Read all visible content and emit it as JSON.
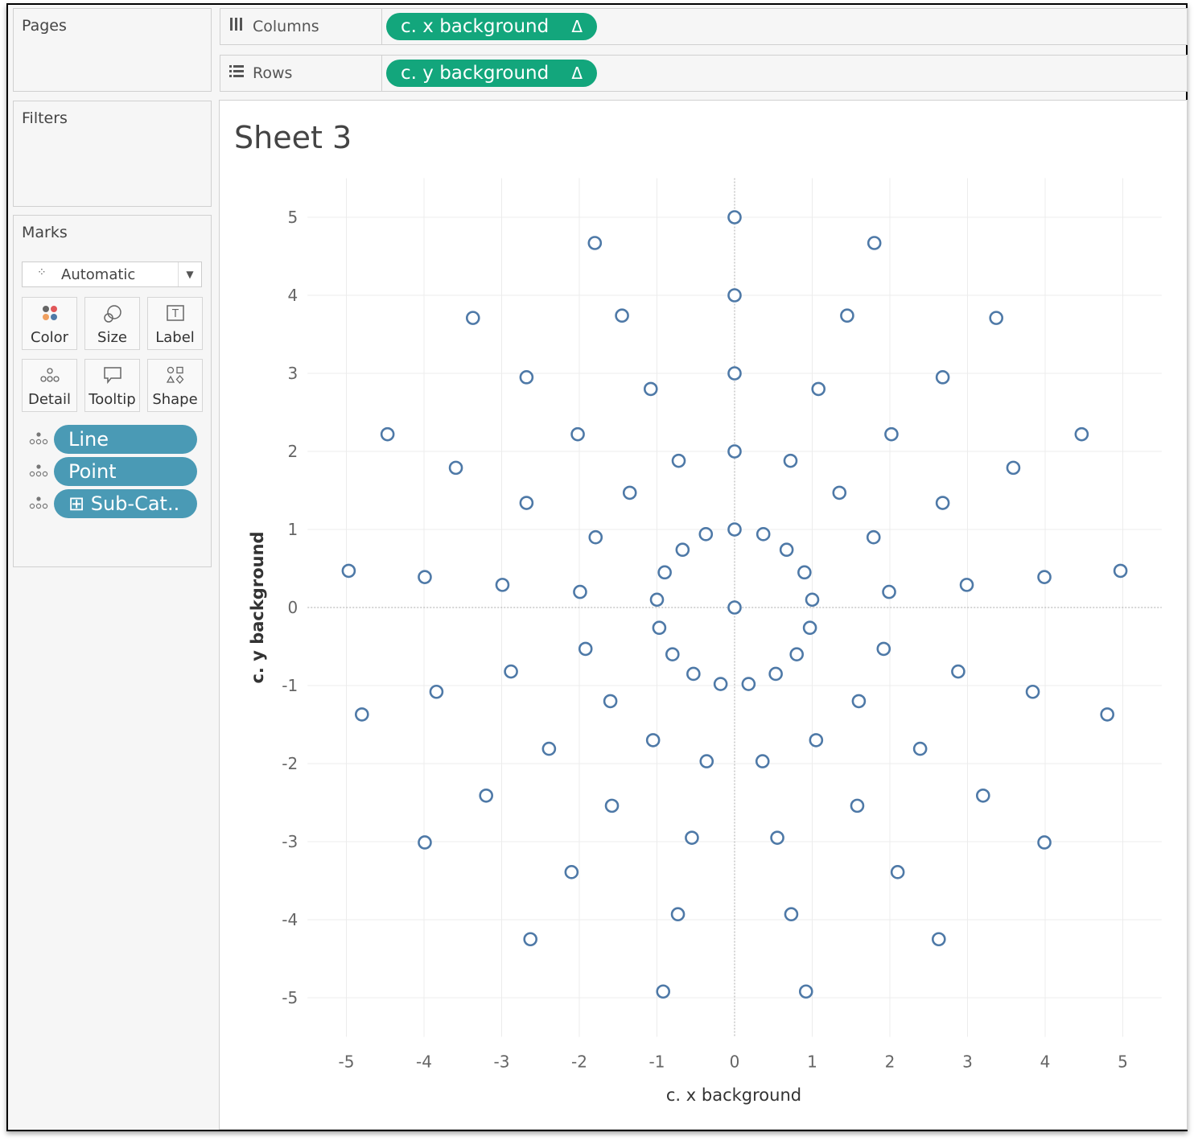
{
  "pages": {
    "title": "Pages"
  },
  "filters": {
    "title": "Filters"
  },
  "marks": {
    "title": "Marks",
    "mark_type": "Automatic",
    "buttons": [
      {
        "label": "Color",
        "icon": "color-icon"
      },
      {
        "label": "Size",
        "icon": "size-icon"
      },
      {
        "label": "Label",
        "icon": "label-icon"
      },
      {
        "label": "Detail",
        "icon": "detail-icon"
      },
      {
        "label": "Tooltip",
        "icon": "tooltip-icon"
      },
      {
        "label": "Shape",
        "icon": "shape-icon"
      }
    ],
    "fields": [
      {
        "label": "Line",
        "icon": "detail-icon"
      },
      {
        "label": "Point",
        "icon": "detail-icon"
      },
      {
        "label": "⊞ Sub-Cat..",
        "icon": "detail-icon"
      }
    ]
  },
  "shelves": {
    "columns": {
      "label": "Columns",
      "pill": "c. x background",
      "pill_symbol": "Δ"
    },
    "rows": {
      "label": "Rows",
      "pill": "c. y background",
      "pill_symbol": "Δ"
    }
  },
  "sheet": {
    "title": "Sheet 3"
  },
  "colors": {
    "pill_green": "#13a67c",
    "pill_blue": "#4a9ab5",
    "mark": "#4e79a7"
  },
  "chart_data": {
    "type": "scatter",
    "xlabel": "c. x background",
    "ylabel": "c. y background",
    "xlim": [
      -5.5,
      5.5
    ],
    "ylim": [
      -5.5,
      5.5
    ],
    "xticks": [
      -5,
      -4,
      -3,
      -2,
      -1,
      0,
      1,
      2,
      3,
      4,
      5
    ],
    "yticks": [
      5,
      4,
      3,
      2,
      1,
      0,
      -1,
      -2,
      -3,
      -4,
      -5
    ],
    "grid": true,
    "zero_lines": true,
    "marker": "hollow-circle",
    "points": [
      [
        0,
        5
      ],
      [
        -1.8,
        4.67
      ],
      [
        1.8,
        4.67
      ],
      [
        0,
        4
      ],
      [
        -1.45,
        3.74
      ],
      [
        1.45,
        3.74
      ],
      [
        -3.37,
        3.71
      ],
      [
        3.37,
        3.71
      ],
      [
        0,
        3
      ],
      [
        -2.68,
        2.95
      ],
      [
        2.68,
        2.95
      ],
      [
        -1.08,
        2.8
      ],
      [
        1.08,
        2.8
      ],
      [
        -4.47,
        2.22
      ],
      [
        -2.02,
        2.22
      ],
      [
        2.02,
        2.22
      ],
      [
        4.47,
        2.22
      ],
      [
        0,
        2
      ],
      [
        -0.72,
        1.88
      ],
      [
        0.72,
        1.88
      ],
      [
        -3.59,
        1.79
      ],
      [
        3.59,
        1.79
      ],
      [
        -1.35,
        1.47
      ],
      [
        1.35,
        1.47
      ],
      [
        -2.68,
        1.34
      ],
      [
        2.68,
        1.34
      ],
      [
        0,
        1
      ],
      [
        -0.37,
        0.94
      ],
      [
        0.37,
        0.94
      ],
      [
        -1.79,
        0.9
      ],
      [
        1.79,
        0.9
      ],
      [
        -0.67,
        0.74
      ],
      [
        0.67,
        0.74
      ],
      [
        -4.97,
        0.47
      ],
      [
        -0.9,
        0.45
      ],
      [
        0.9,
        0.45
      ],
      [
        4.97,
        0.47
      ],
      [
        -3.99,
        0.39
      ],
      [
        3.99,
        0.39
      ],
      [
        -2.99,
        0.29
      ],
      [
        2.99,
        0.29
      ],
      [
        -1.99,
        0.2
      ],
      [
        1.99,
        0.2
      ],
      [
        -1,
        0.1
      ],
      [
        1,
        0.1
      ],
      [
        0,
        0
      ],
      [
        -0.97,
        -0.26
      ],
      [
        0.97,
        -0.26
      ],
      [
        -1.92,
        -0.53
      ],
      [
        1.92,
        -0.53
      ],
      [
        -0.8,
        -0.6
      ],
      [
        0.8,
        -0.6
      ],
      [
        -2.88,
        -0.82
      ],
      [
        2.88,
        -0.82
      ],
      [
        -0.53,
        -0.85
      ],
      [
        0.53,
        -0.85
      ],
      [
        -0.18,
        -0.98
      ],
      [
        0.18,
        -0.98
      ],
      [
        -3.84,
        -1.08
      ],
      [
        3.84,
        -1.08
      ],
      [
        -1.6,
        -1.2
      ],
      [
        1.6,
        -1.2
      ],
      [
        -4.8,
        -1.37
      ],
      [
        4.8,
        -1.37
      ],
      [
        -1.05,
        -1.7
      ],
      [
        1.05,
        -1.7
      ],
      [
        -2.39,
        -1.81
      ],
      [
        2.39,
        -1.81
      ],
      [
        -0.36,
        -1.97
      ],
      [
        0.36,
        -1.97
      ],
      [
        -3.2,
        -2.41
      ],
      [
        3.2,
        -2.41
      ],
      [
        -1.58,
        -2.54
      ],
      [
        1.58,
        -2.54
      ],
      [
        -0.55,
        -2.95
      ],
      [
        0.55,
        -2.95
      ],
      [
        -3.99,
        -3.01
      ],
      [
        3.99,
        -3.01
      ],
      [
        -2.1,
        -3.39
      ],
      [
        2.1,
        -3.39
      ],
      [
        -0.73,
        -3.93
      ],
      [
        0.73,
        -3.93
      ],
      [
        -2.63,
        -4.25
      ],
      [
        2.63,
        -4.25
      ],
      [
        -0.92,
        -4.92
      ],
      [
        0.92,
        -4.92
      ]
    ]
  }
}
